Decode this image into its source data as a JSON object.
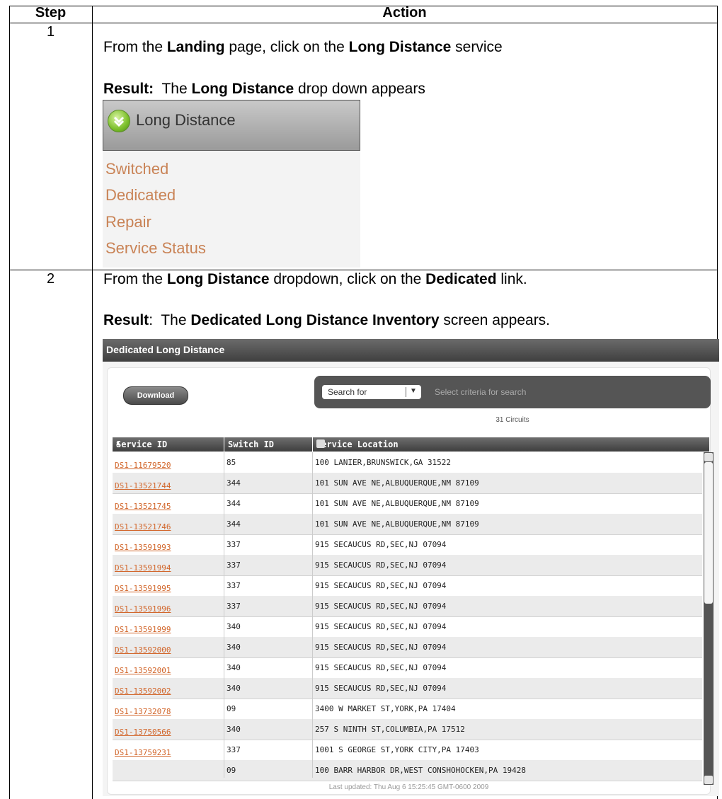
{
  "table_headers": {
    "step": "Step",
    "action": "Action"
  },
  "steps": [
    {
      "number": "1",
      "line1": {
        "pre": "From the ",
        "b1": "Landing",
        "mid": " page, click on the ",
        "b2": "Long Distance",
        "post": " service"
      },
      "result": {
        "label": "Result:",
        "pre": "  The ",
        "b1": "Long Distance",
        "post": " drop down appears"
      }
    },
    {
      "number": "2",
      "line1": {
        "pre": "From the ",
        "b1": "Long Distance",
        "mid": " dropdown, click on the ",
        "b2": "Dedicated",
        "post": " link."
      },
      "result": {
        "label": "Result",
        "pre": ":  The ",
        "b1": "Dedicated Long Distance Inventory",
        "post": " screen appears."
      }
    }
  ],
  "ld_menu": {
    "title": "Long Distance",
    "items": [
      "Switched",
      "Dedicated",
      "Repair",
      "Service Status"
    ],
    "logo_color": "#7bbf2a",
    "link_color": "#c98356"
  },
  "dedicated": {
    "title": "Dedicated Long Distance",
    "download_label": "Download",
    "search": {
      "selected": "Search for",
      "hint": "Select criteria for search"
    },
    "count": "31 Circuits",
    "columns": [
      "Service ID",
      "Switch ID",
      "Service Location"
    ],
    "sort_icon": "▲",
    "rows": [
      [
        "DS1-11679520",
        "85",
        "100 LANIER,BRUNSWICK,GA 31522"
      ],
      [
        "DS1-13521744",
        "344",
        "101 SUN AVE NE,ALBUQUERQUE,NM 87109"
      ],
      [
        "DS1-13521745",
        "344",
        "101 SUN AVE NE,ALBUQUERQUE,NM 87109"
      ],
      [
        "DS1-13521746",
        "344",
        "101 SUN AVE NE,ALBUQUERQUE,NM 87109"
      ],
      [
        "DS1-13591993",
        "337",
        "915 SECAUCUS RD,SEC,NJ 07094"
      ],
      [
        "DS1-13591994",
        "337",
        "915 SECAUCUS RD,SEC,NJ 07094"
      ],
      [
        "DS1-13591995",
        "337",
        "915 SECAUCUS RD,SEC,NJ 07094"
      ],
      [
        "DS1-13591996",
        "337",
        "915 SECAUCUS RD,SEC,NJ 07094"
      ],
      [
        "DS1-13591999",
        "340",
        "915 SECAUCUS RD,SEC,NJ 07094"
      ],
      [
        "DS1-13592000",
        "340",
        "915 SECAUCUS RD,SEC,NJ 07094"
      ],
      [
        "DS1-13592001",
        "340",
        "915 SECAUCUS RD,SEC,NJ 07094"
      ],
      [
        "DS1-13592002",
        "340",
        "915 SECAUCUS RD,SEC,NJ 07094"
      ],
      [
        "DS1-13732078",
        "09",
        "3400 W MARKET ST,YORK,PA 17404"
      ],
      [
        "DS1-13750566",
        "340",
        "257 S NINTH ST,COLUMBIA,PA 17512"
      ],
      [
        "DS1-13759231",
        "337",
        "1001 S GEORGE ST,YORK CITY,PA 17403"
      ],
      [
        "",
        "09",
        "100 BARR HARBOR DR,WEST CONSHOHOCKEN,PA 19428"
      ]
    ],
    "footer": "Last updated: Thu Aug 6 15:25:45 GMT-0600 2009",
    "link_color": "#d2672c"
  }
}
